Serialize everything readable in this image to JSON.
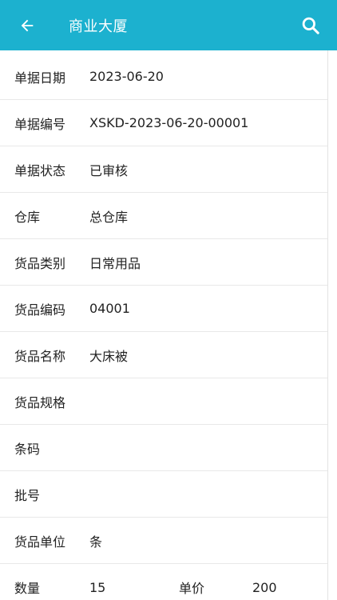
{
  "header": {
    "title": "商业大厦",
    "back_icon": "arrow-left-icon",
    "search_icon": "search-icon",
    "accent_color": "#1cb1cf"
  },
  "fields": [
    {
      "label": "单据日期",
      "value": "2023-06-20"
    },
    {
      "label": "单据编号",
      "value": "XSKD-2023-06-20-00001"
    },
    {
      "label": "单据状态",
      "value": "已审核"
    },
    {
      "label": "仓库",
      "value": "总仓库"
    },
    {
      "label": "货品类别",
      "value": "日常用品"
    },
    {
      "label": "货品编码",
      "value": "04001"
    },
    {
      "label": "货品名称",
      "value": "大床被"
    },
    {
      "label": "货品规格",
      "value": ""
    },
    {
      "label": "条码",
      "value": ""
    },
    {
      "label": "批号",
      "value": ""
    },
    {
      "label": "货品单位",
      "value": "条"
    }
  ],
  "quantity_row": {
    "qty_label": "数量",
    "qty_value": "15",
    "price_label": "单价",
    "price_value": "200"
  }
}
